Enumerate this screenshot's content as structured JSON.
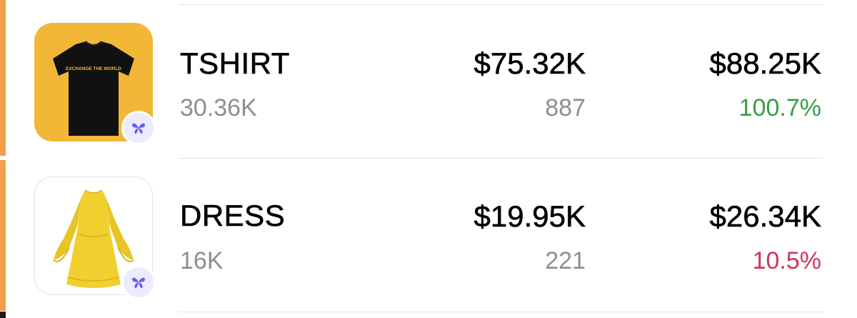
{
  "colors": {
    "accent_strip": "#f2a04c",
    "badge_bg": "#ecebff",
    "badge_icon": "#6a5cf0",
    "positive": "#3a9b45",
    "negative": "#d0345a",
    "muted_text": "#8e8e93"
  },
  "products": [
    {
      "name": "TSHIRT",
      "subtitle": "30.36K",
      "col2_value": "$75.32K",
      "col2_sub": "887",
      "col3_value": "$88.25K",
      "col3_sub": "100.7%",
      "col3_trend": "up",
      "image": "black-tshirt",
      "shirt_print": "EXCHANGE THE WORLD",
      "badge_icon": "butterfly-icon"
    },
    {
      "name": "DRESS",
      "subtitle": "16K",
      "col2_value": "$19.95K",
      "col2_sub": "221",
      "col3_value": "$26.34K",
      "col3_sub": "10.5%",
      "col3_trend": "down",
      "image": "yellow-dress",
      "badge_icon": "butterfly-icon"
    }
  ]
}
